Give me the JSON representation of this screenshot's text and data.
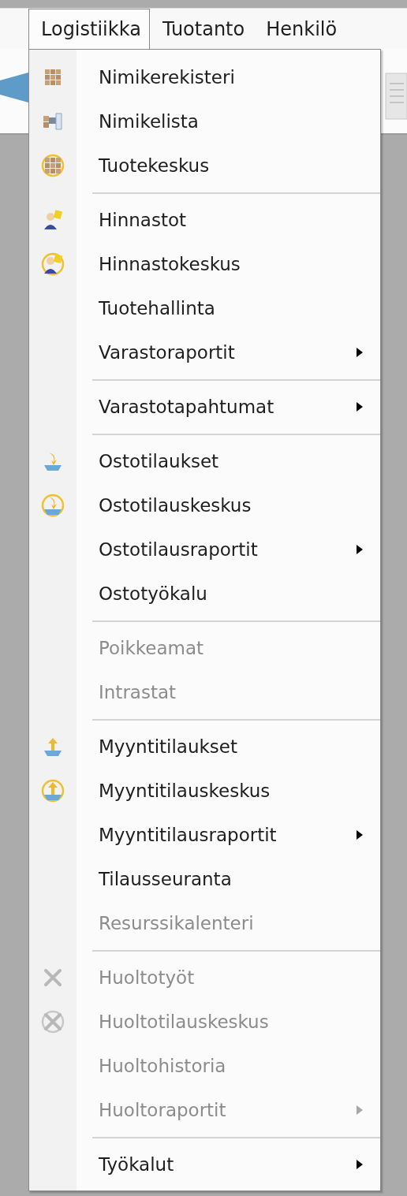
{
  "menu_bar": [
    {
      "label": "Logistiikka",
      "selected": true
    },
    {
      "label": "Tuotanto",
      "selected": false
    },
    {
      "label": "Henkilö",
      "selected": false
    }
  ],
  "dropdown": {
    "groups": [
      {
        "items": [
          {
            "label": "Nimikerekisteri",
            "kind": "boxes",
            "disabled": false,
            "submenu": false
          },
          {
            "label": "Nimikelista",
            "kind": "list",
            "disabled": false,
            "submenu": false
          },
          {
            "label": "Tuotekeskus",
            "kind": "boxes-hub",
            "disabled": false,
            "submenu": false
          }
        ]
      },
      {
        "items": [
          {
            "label": "Hinnastot",
            "kind": "person",
            "disabled": false,
            "submenu": false
          },
          {
            "label": "Hinnastokeskus",
            "kind": "person-hub",
            "disabled": false,
            "submenu": false
          },
          {
            "label": "Tuotehallinta",
            "disabled": false,
            "submenu": false
          },
          {
            "label": "Varastoraportit",
            "disabled": false,
            "submenu": true
          }
        ]
      },
      {
        "items": [
          {
            "label": "Varastotapahtumat",
            "disabled": false,
            "submenu": true
          }
        ]
      },
      {
        "items": [
          {
            "label": "Ostotilaukset",
            "kind": "arrow-down",
            "disabled": false,
            "submenu": false
          },
          {
            "label": "Ostotilauskeskus",
            "kind": "arrow-down-hub",
            "disabled": false,
            "submenu": false
          },
          {
            "label": "Ostotilausraportit",
            "disabled": false,
            "submenu": true
          },
          {
            "label": "Ostotyökalu",
            "disabled": false,
            "submenu": false
          }
        ]
      },
      {
        "items": [
          {
            "label": "Poikkeamat",
            "disabled": true,
            "submenu": false
          },
          {
            "label": "Intrastat",
            "disabled": true,
            "submenu": false
          }
        ]
      },
      {
        "items": [
          {
            "label": "Myyntitilaukset",
            "kind": "arrow-up",
            "disabled": false,
            "submenu": false
          },
          {
            "label": "Myyntitilauskeskus",
            "kind": "arrow-up-hub",
            "disabled": false,
            "submenu": false
          },
          {
            "label": "Myyntitilausraportit",
            "disabled": false,
            "submenu": true
          },
          {
            "label": "Tilausseuranta",
            "disabled": false,
            "submenu": false
          },
          {
            "label": "Resurssikalenteri",
            "disabled": true,
            "submenu": false
          }
        ]
      },
      {
        "items": [
          {
            "label": "Huoltotyöt",
            "kind": "tools",
            "disabled": true,
            "submenu": false
          },
          {
            "label": "Huoltotilauskeskus",
            "kind": "tools-hub",
            "disabled": true,
            "submenu": false
          },
          {
            "label": "Huoltohistoria",
            "disabled": true,
            "submenu": false
          },
          {
            "label": "Huoltoraportit",
            "disabled": true,
            "submenu": true
          }
        ]
      },
      {
        "items": [
          {
            "label": "Työkalut",
            "disabled": false,
            "submenu": true
          }
        ]
      }
    ]
  }
}
